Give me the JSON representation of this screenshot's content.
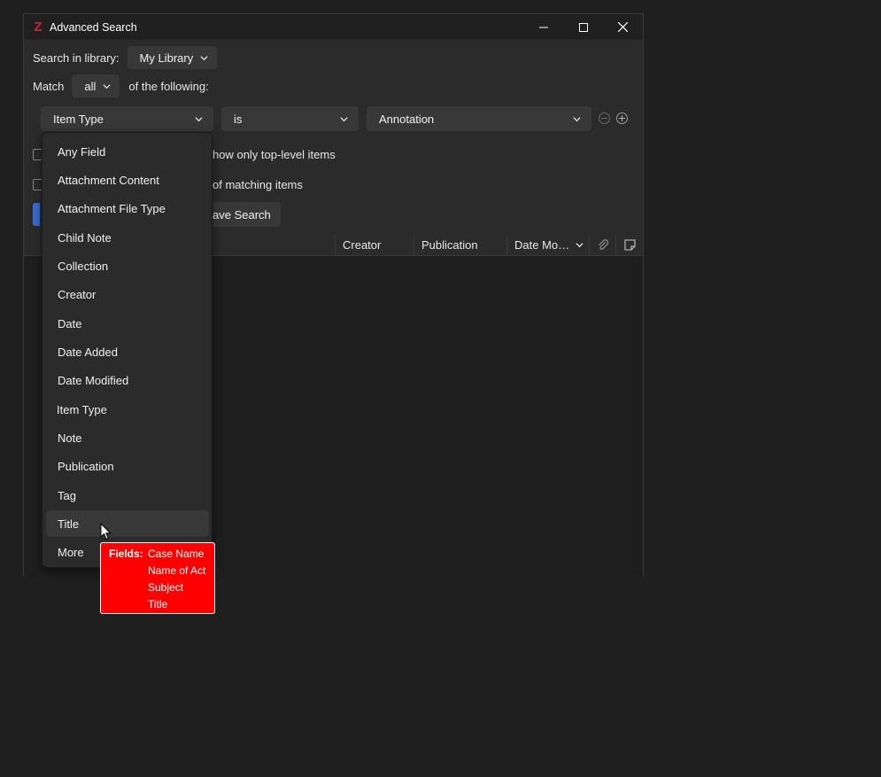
{
  "window": {
    "title": "Advanced Search",
    "logo_letter": "Z",
    "accent_color": "#d3203a",
    "controls": [
      "minimize-icon",
      "maximize-icon",
      "close-icon"
    ]
  },
  "search_in": {
    "label": "Search in library:",
    "value": "My Library"
  },
  "match": {
    "label": "Match",
    "value": "all",
    "suffix": "of the following:"
  },
  "condition": {
    "field": "Item Type",
    "operator": "is",
    "value": "Annotation"
  },
  "options": {
    "top_level": "how only top-level items",
    "matching": "of matching items"
  },
  "buttons": {
    "save_search": "ave Search"
  },
  "columns": {
    "creator": "Creator",
    "publication": "Publication",
    "date_modified": "Date Mo…"
  },
  "field_menu": {
    "items": [
      "Any Field",
      "Attachment Content",
      "Attachment File Type",
      "Child Note",
      "Collection",
      "Creator",
      "Date",
      "Date Added",
      "Date Modified",
      "Item Type",
      "Note",
      "Publication",
      "Tag",
      "Title",
      "More"
    ],
    "hovered": "Title"
  },
  "tooltip": {
    "label": "Fields:",
    "values": [
      "Case Name",
      "Name of Act",
      "Subject",
      "Title"
    ],
    "background": "#ff0000"
  }
}
